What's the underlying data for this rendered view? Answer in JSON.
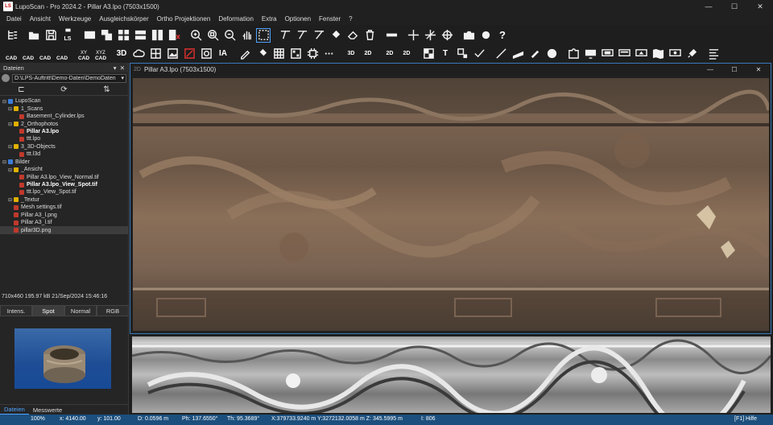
{
  "window": {
    "title": "LupoScan - Pro 2024.2 - Pillar A3.lpo (7503x1500)",
    "app_icon": "LS",
    "buttons": [
      "—",
      "☐",
      "✕"
    ]
  },
  "menu": [
    "Datei",
    "Ansicht",
    "Werkzeuge",
    "Ausgleichskörper",
    "Ortho Projektionen",
    "Deformation",
    "Extra",
    "Optionen",
    "Fenster",
    "?"
  ],
  "toolbar2_cad": [
    {
      "top": "",
      "label": "CAD"
    },
    {
      "top": "",
      "label": "CAD"
    },
    {
      "top": "",
      "label": "CAD"
    },
    {
      "top": "",
      "label": "CAD"
    },
    {
      "top": "XY",
      "label": "CAD"
    },
    {
      "top": "XYZ",
      "label": "CAD"
    }
  ],
  "toolbar_labels": {
    "ls": "LS",
    "t3d": "3D",
    "ia": "IA",
    "t3dd": "3D",
    "t2d": "2D",
    "t2dz": "2D",
    "t2di": "2D",
    "tT": "T"
  },
  "files_panel": {
    "title": "Dateien",
    "close": "✕",
    "pin": "▾",
    "path": "D:\\LPS-Auftritt\\Demo-Daten\\DemoDaten",
    "tree": [
      {
        "text": "LupoScan",
        "indent": 0,
        "exp": "⊟",
        "bold": false,
        "selected": false,
        "icon": "#3b7dd8"
      },
      {
        "text": "1_Scans",
        "indent": 1,
        "exp": "⊟",
        "bold": false,
        "selected": false,
        "icon": "#e0b000"
      },
      {
        "text": "Basement_Cylinder.lps",
        "indent": 2,
        "exp": "",
        "bold": false,
        "selected": false,
        "icon": "#c0392b"
      },
      {
        "text": "2_Orthophotos",
        "indent": 1,
        "exp": "⊟",
        "bold": false,
        "selected": false,
        "icon": "#e0b000"
      },
      {
        "text": "Pillar A3.lpo",
        "indent": 2,
        "exp": "",
        "bold": true,
        "selected": false,
        "icon": "#c0392b"
      },
      {
        "text": "ttt.lpo",
        "indent": 2,
        "exp": "",
        "bold": false,
        "selected": false,
        "icon": "#c0392b"
      },
      {
        "text": "3_3D-Objects",
        "indent": 1,
        "exp": "⊟",
        "bold": false,
        "selected": false,
        "icon": "#e0b000"
      },
      {
        "text": "ttt.l3d",
        "indent": 2,
        "exp": "",
        "bold": false,
        "selected": false,
        "icon": "#c0392b"
      },
      {
        "text": "Bilder",
        "indent": 0,
        "exp": "⊟",
        "bold": false,
        "selected": false,
        "icon": "#3b7dd8"
      },
      {
        "text": "_Ansicht",
        "indent": 1,
        "exp": "⊟",
        "bold": false,
        "selected": false,
        "icon": "#e0b000"
      },
      {
        "text": "Pillar A3.lpo_View_Normal.tif",
        "indent": 2,
        "exp": "",
        "bold": false,
        "selected": false,
        "icon": "#c0392b"
      },
      {
        "text": "Pillar A3.lpo_View_Spot.tif",
        "indent": 2,
        "exp": "",
        "bold": true,
        "selected": false,
        "icon": "#c0392b"
      },
      {
        "text": "ttt.lpo_View_Spot.tif",
        "indent": 2,
        "exp": "",
        "bold": false,
        "selected": false,
        "icon": "#c0392b"
      },
      {
        "text": "_Textur",
        "indent": 1,
        "exp": "⊟",
        "bold": false,
        "selected": false,
        "icon": "#e0b000"
      },
      {
        "text": "Mesh settings.tif",
        "indent": 1,
        "exp": "",
        "bold": false,
        "selected": false,
        "icon": "#c0392b"
      },
      {
        "text": "Pillar A3_l.png",
        "indent": 1,
        "exp": "",
        "bold": false,
        "selected": false,
        "icon": "#c0392b"
      },
      {
        "text": "Pillar A3_l.tif",
        "indent": 1,
        "exp": "",
        "bold": false,
        "selected": false,
        "icon": "#c0392b"
      },
      {
        "text": "pillar3D.png",
        "indent": 1,
        "exp": "",
        "bold": false,
        "selected": true,
        "icon": "#c0392b"
      }
    ],
    "info": "710x460   195.97 kB   21/Sep/2024   15:46:16",
    "mode_tabs": [
      "Intens.",
      "Spot",
      "Normal",
      "RGB"
    ],
    "active_mode": 1,
    "bottom_tabs": [
      "Dateien",
      "Messwerte"
    ]
  },
  "document": {
    "badge": "2D",
    "title": "Pillar A3.lpo (7503x1500)",
    "buttons": [
      "—",
      "☐",
      "✕"
    ]
  },
  "status": {
    "zoom": "100%",
    "x": "x:  4140.00",
    "y": "y:  101.00",
    "d": "D: 0.0596 m",
    "ph": "Ph: 137.6550°",
    "th": "Th:  95.3689°",
    "xyz": "X:379733.9240 m  Y:3272132.0058 m  Z: 345.5995 m",
    "i": "I:  806",
    "help": "[F1] Hilfe"
  },
  "colors": {
    "accent": "#1c4f7d",
    "doc_border": "#3a78b8",
    "selected_tab": "#4ea3ff"
  }
}
